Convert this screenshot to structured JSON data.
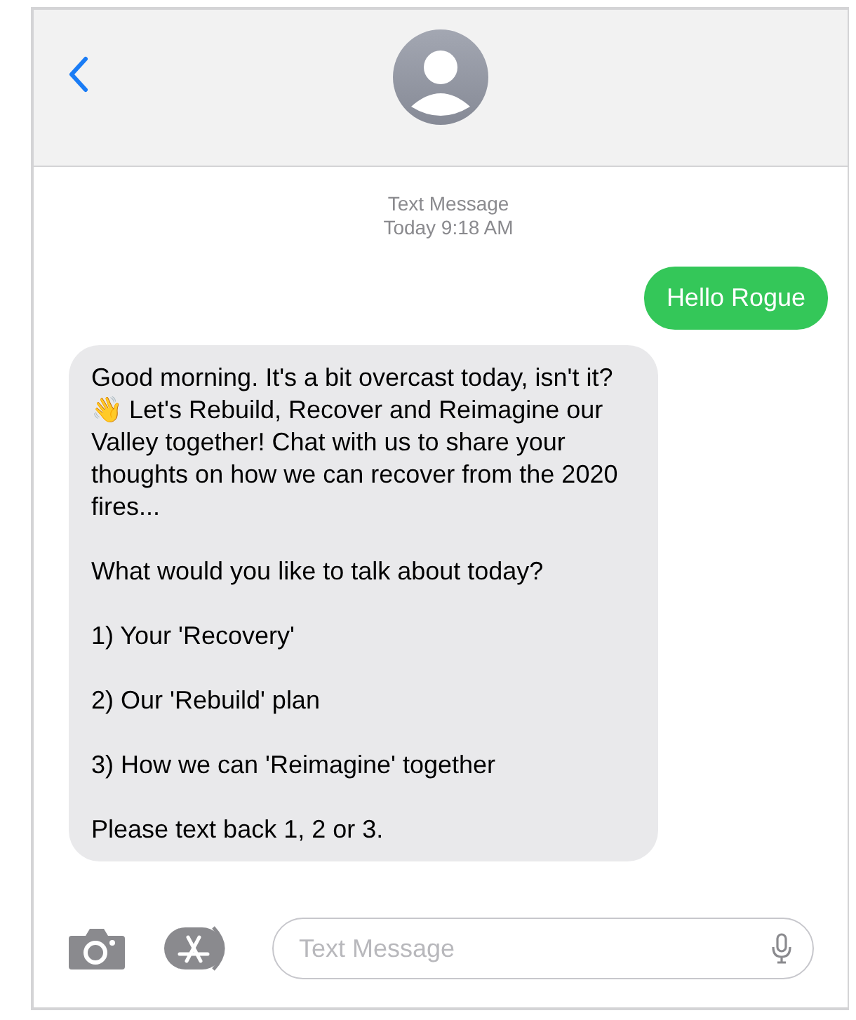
{
  "timestamp": {
    "label": "Text Message",
    "time": "Today 9:18 AM"
  },
  "messages": [
    {
      "kind": "sent",
      "paragraphs": [
        "Hello Rogue"
      ]
    },
    {
      "kind": "received",
      "paragraphs": [
        "Good morning. It's a bit overcast today, isn't it? 👋 Let's Rebuild, Recover and Reimagine our Valley together! Chat with us to share your thoughts on how we can recover from the 2020 fires...",
        "What would you like to talk about today?",
        "1) Your 'Recovery'",
        "2) Our 'Rebuild' plan",
        "3) How we can 'Reimagine' together",
        "Please text back 1, 2 or 3."
      ]
    }
  ],
  "composer": {
    "placeholder": "Text Message"
  }
}
